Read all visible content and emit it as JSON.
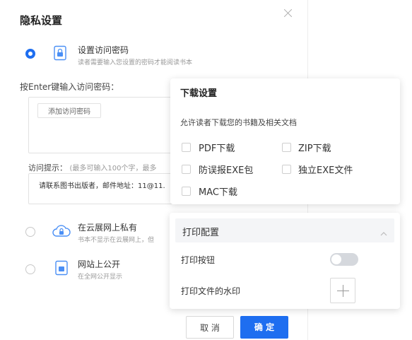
{
  "modal": {
    "title": "隐私设置",
    "options": [
      {
        "title": "设置访问密码",
        "desc": "读者需要输入您设置的密码才能阅读书本",
        "selected": true,
        "icon": "lock-doc-icon"
      },
      {
        "title": "在云展网上私有",
        "desc": "书本不显示在云展网上，但",
        "selected": false,
        "icon": "cloud-lock-icon"
      },
      {
        "title": "网站上公开",
        "desc": "在全网公开显示",
        "selected": false,
        "icon": "doc-icon"
      }
    ],
    "password_label": "按Enter键输入访问密码：",
    "add_password_button": "添加访问密码",
    "hint_label": "访问提示：",
    "hint_note": "(最多可输入100个字，最多",
    "hint_text": "请联系图书出版者，邮件地址：11@11.",
    "cancel_label": "取 消",
    "ok_label": "确 定"
  },
  "download_panel": {
    "title": "下载设置",
    "desc": "允许读者下载您的书籍及相关文档",
    "options": [
      {
        "label": "PDF下载",
        "checked": false
      },
      {
        "label": "ZIP下载",
        "checked": false
      },
      {
        "label": "防误报EXE包",
        "checked": false
      },
      {
        "label": "独立EXE文件",
        "checked": false
      },
      {
        "label": "MAC下载",
        "checked": false
      }
    ]
  },
  "print_panel": {
    "title": "打印配置",
    "print_button_label": "打印按钮",
    "print_button_enabled": false,
    "watermark_label": "打印文件的水印"
  },
  "colors": {
    "accent": "#1e6ef0",
    "toggle_off": "#d5d8dd"
  }
}
